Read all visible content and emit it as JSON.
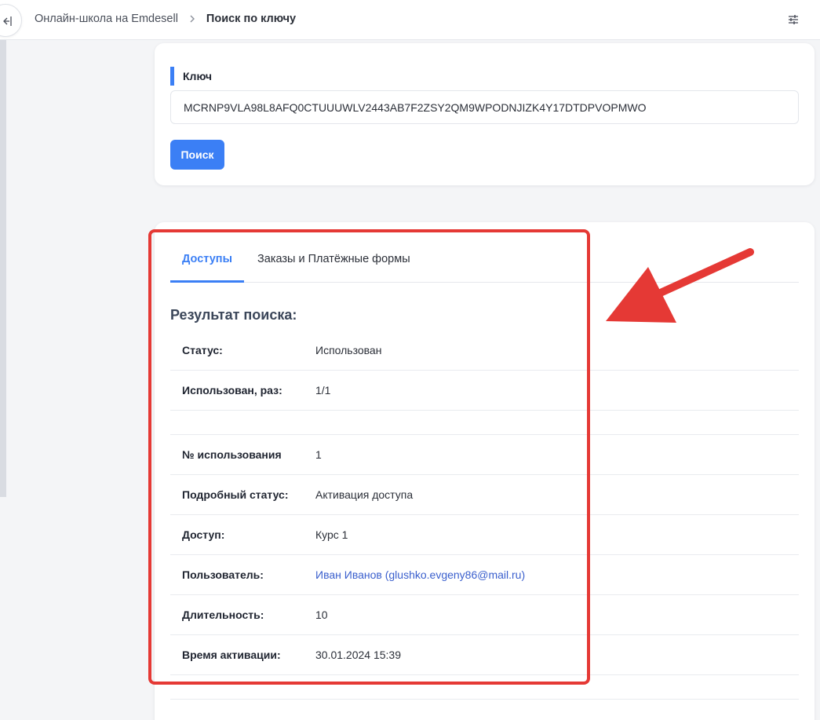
{
  "header": {
    "breadcrumb_root": "Онлайн-школа на Emdesell",
    "breadcrumb_current": "Поиск по ключу",
    "collapse_icon": "collapse-sidebar-icon",
    "settings_icon": "sliders-icon"
  },
  "search_form": {
    "label": "Ключ",
    "key_value": "MCRNP9VLA98L8AFQ0CTUUUWLV2443AB7F2ZSY2QM9WPODNJIZK4Y17DTDPVOPMWO",
    "button_label": "Поиск"
  },
  "tabs": [
    {
      "label": "Доступы",
      "active": true
    },
    {
      "label": "Заказы и Платёжные формы",
      "active": false
    }
  ],
  "result": {
    "title": "Результат поиска:",
    "rows": [
      {
        "label": "Статус:",
        "value": "Использован"
      },
      {
        "label": "Использован, раз:",
        "value": "1/1"
      },
      {
        "label": "№ использования",
        "value": "1"
      },
      {
        "label": "Подробный статус:",
        "value": "Активация доступа"
      },
      {
        "label": "Доступ:",
        "value": "Курс 1"
      },
      {
        "label": "Пользователь:",
        "value": "Иван Иванов (glushko.evgeny86@mail.ru)"
      },
      {
        "label": "Длительность:",
        "value": "10"
      },
      {
        "label": "Время активации:",
        "value": "30.01.2024 15:39"
      }
    ]
  },
  "colors": {
    "accent": "#3b7ff5",
    "annotation": "#e53935",
    "link": "#3a5fcd"
  }
}
